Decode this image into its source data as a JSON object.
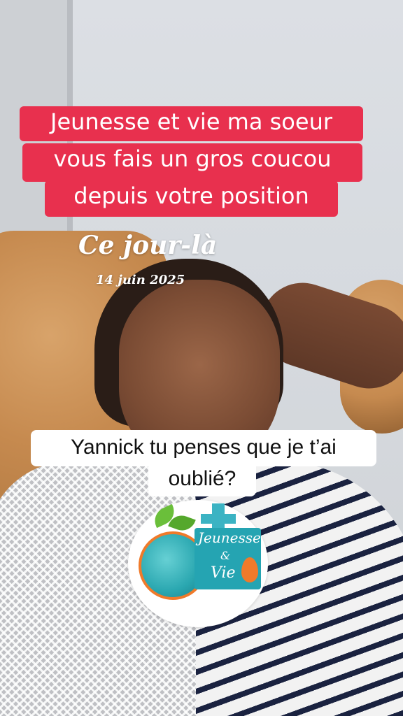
{
  "captions": [
    "Jeunesse et vie ma soeur",
    "vous fais un gros coucou",
    "depuis votre position"
  ],
  "memory": {
    "title": "Ce jour-là",
    "date": "14 juin 2025"
  },
  "subtitle": {
    "line1": "Yannick tu penses que je t’ai",
    "line2": "oublié?"
  },
  "logo": {
    "word1": "Jeunesse",
    "amp": "&",
    "word2": "Vie"
  }
}
